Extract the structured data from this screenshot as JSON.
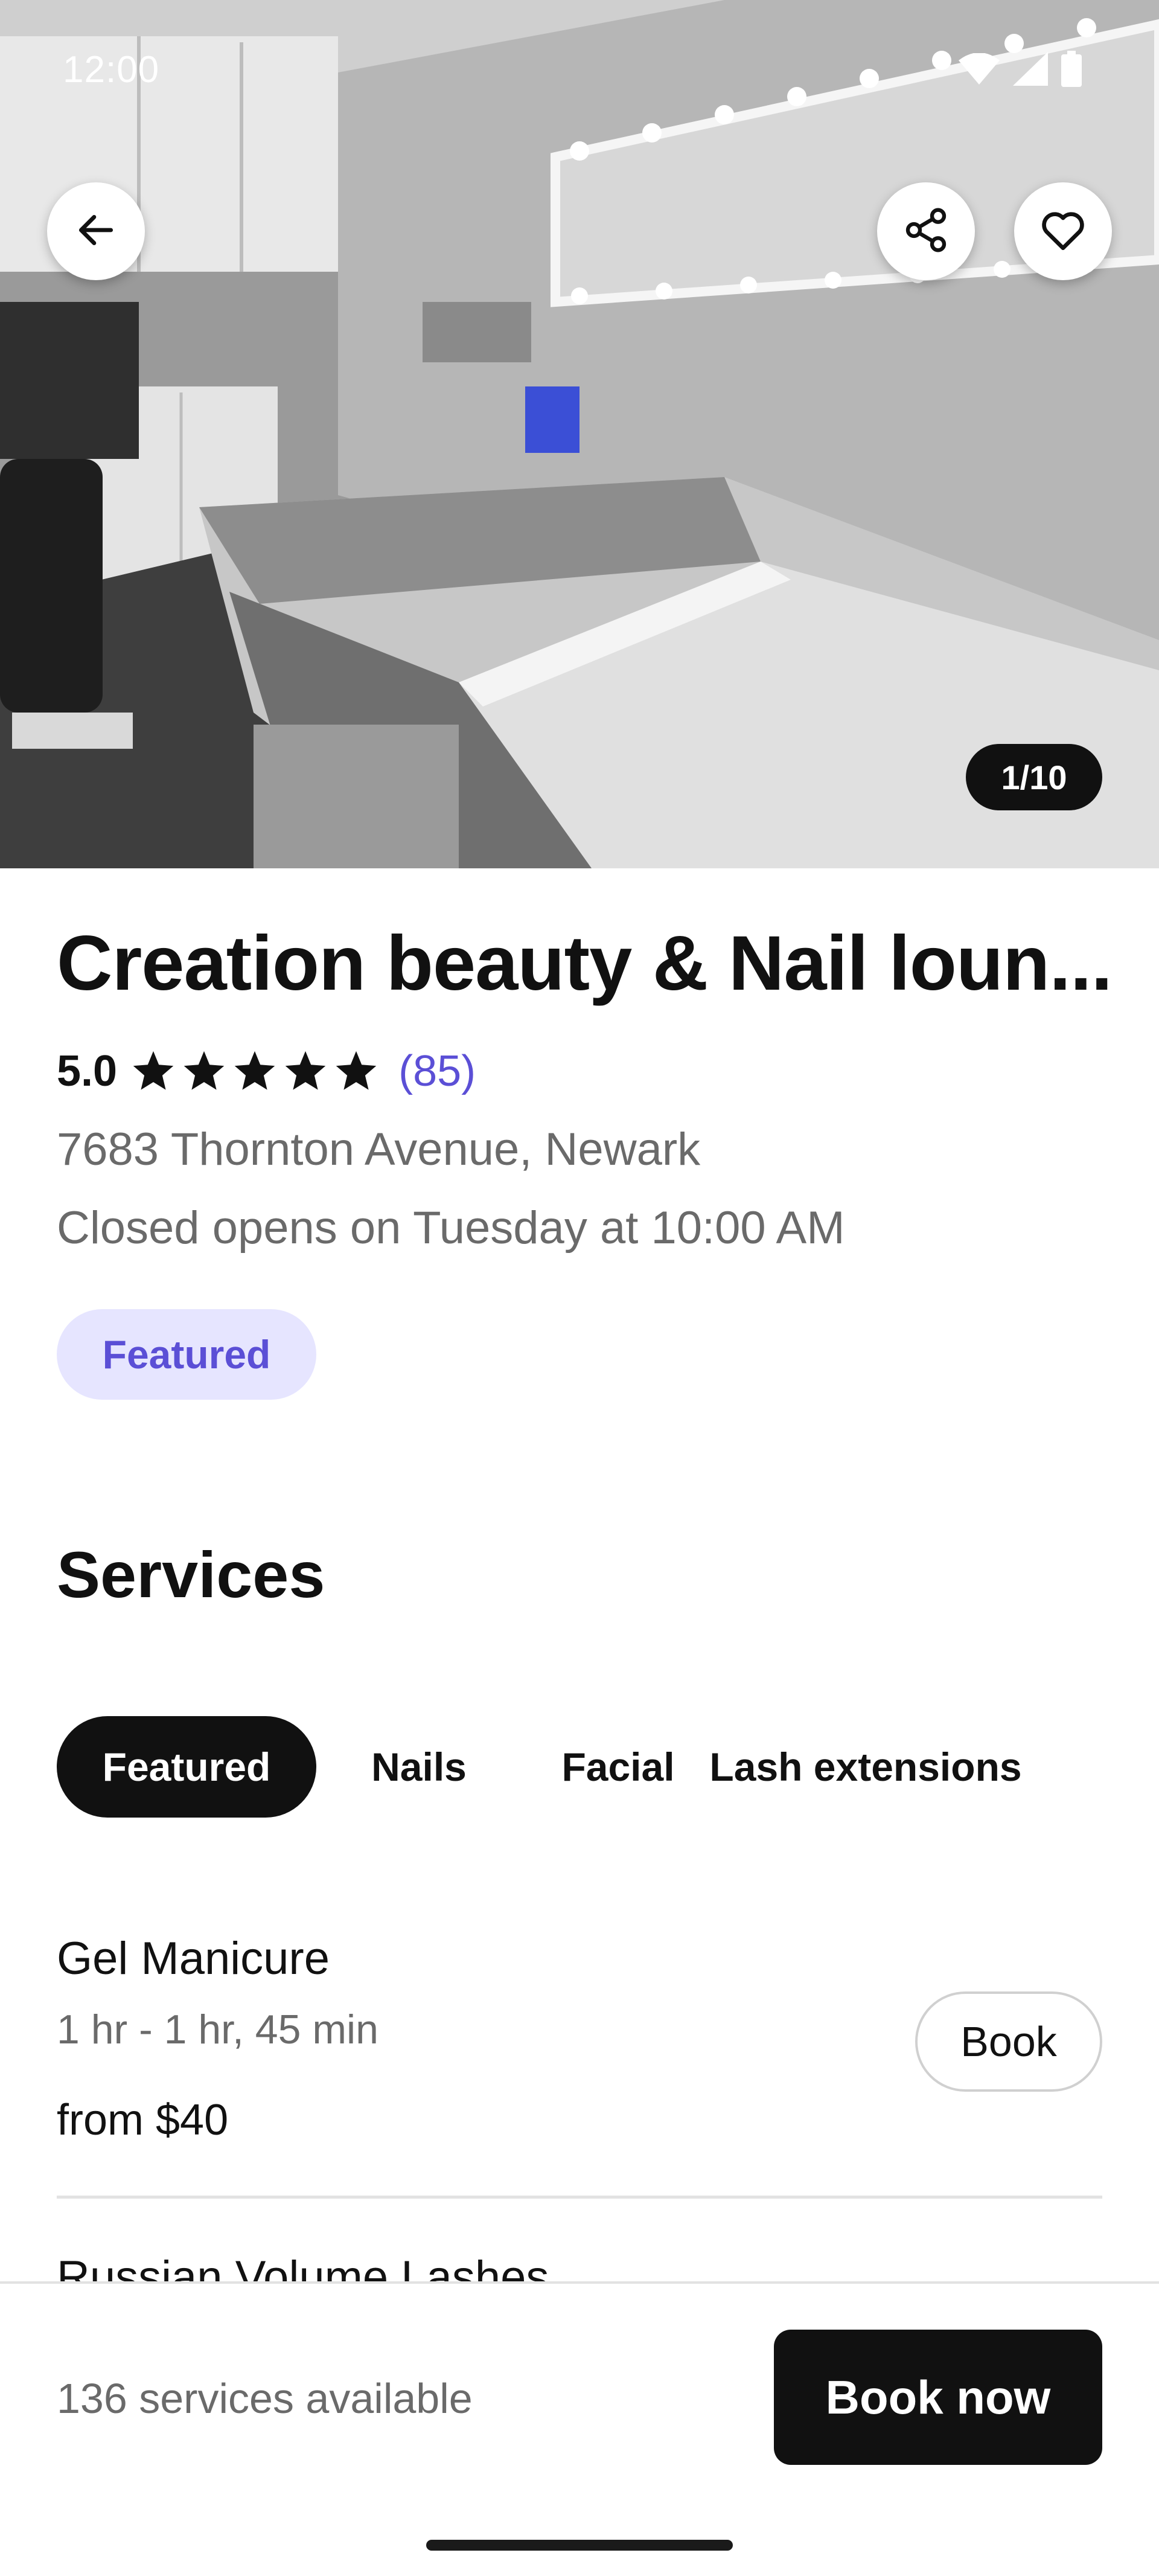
{
  "status_bar": {
    "time": "12:00",
    "icons": [
      "wifi-icon",
      "cellular-signal-icon",
      "battery-icon"
    ]
  },
  "hero": {
    "icons": {
      "back": "arrow-left-icon",
      "share": "share-icon",
      "favorite": "heart-outline-icon"
    },
    "photo_counter": "1/10"
  },
  "business": {
    "name": "Creation beauty & Nail loun...",
    "rating": "5.0",
    "stars": 5,
    "review_count": "(85)",
    "address": "7683 Thornton Avenue, Newark",
    "hours": "Closed opens on Tuesday at 10:00 AM",
    "badge": "Featured"
  },
  "services": {
    "heading": "Services",
    "tabs": [
      {
        "label": "Featured",
        "active": true
      },
      {
        "label": "Nails",
        "active": false
      },
      {
        "label": "Facial",
        "active": false
      },
      {
        "label": "Lash extensions",
        "active": false
      }
    ],
    "items": [
      {
        "name": "Gel Manicure",
        "duration": "1 hr - 1 hr, 45 min",
        "price": "from $40",
        "book_label": "Book"
      },
      {
        "name": "Russian Volume Lashes"
      }
    ]
  },
  "footer": {
    "services_available": "136 services available",
    "book_now_label": "Book now"
  },
  "colors": {
    "accent": "#5b4fd6",
    "badge_background": "#e6e5ff",
    "primary_button": "#111111"
  }
}
